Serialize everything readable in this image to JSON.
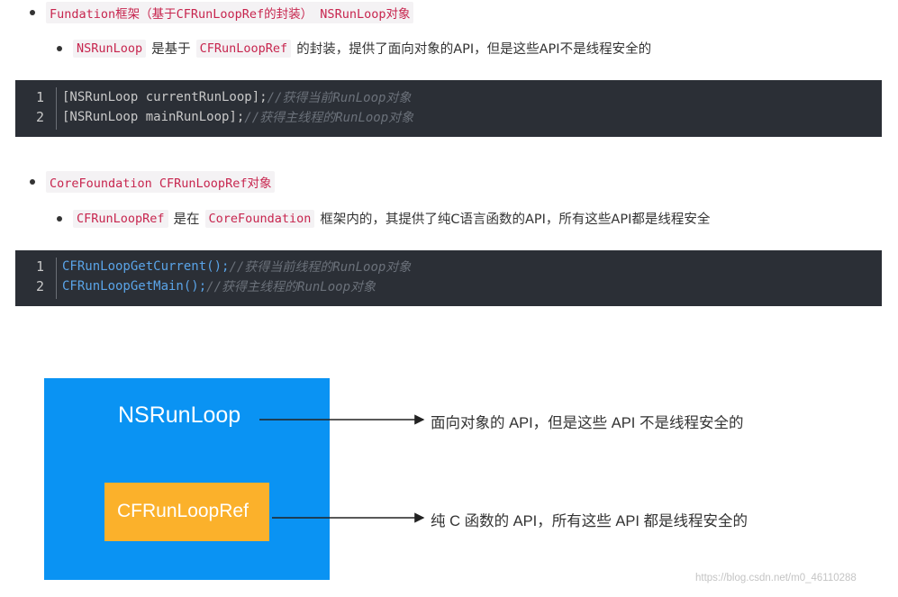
{
  "section1": {
    "heading_code": "Fundation框架（基于CFRunLoopRef的封装） NSRunLoop对象",
    "sub_code": "NSRunLoop",
    "sub_text1": "是基于",
    "sub_code2": "CFRunLoopRef",
    "sub_text2": "的封装，提供了面向对象的API，但是这些API不是线程安全的"
  },
  "code1": {
    "lines": [
      {
        "num": "1",
        "code": "[NSRunLoop currentRunLoop];",
        "comment": "//获得当前RunLoop对象"
      },
      {
        "num": "2",
        "code": "[NSRunLoop mainRunLoop];",
        "comment": "//获得主线程的RunLoop对象"
      }
    ]
  },
  "section2": {
    "heading_code": "CoreFoundation CFRunLoopRef对象",
    "sub_code": "CFRunLoopRef",
    "sub_text1": "是在",
    "sub_code2": "CoreFoundation",
    "sub_text2": "框架内的，其提供了纯C语言函数的API，所有这些API都是线程安全"
  },
  "code2": {
    "lines": [
      {
        "num": "1",
        "code": "CFRunLoopGetCurrent();",
        "comment": "//获得当前线程的RunLoop对象"
      },
      {
        "num": "2",
        "code": "CFRunLoopGetMain();",
        "comment": "//获得主线程的RunLoop对象"
      }
    ]
  },
  "diagram": {
    "outer_label": "NSRunLoop",
    "inner_label": "CFRunLoopRef",
    "outer_desc": "面向对象的 API，但是这些 API 不是线程安全的",
    "inner_desc": "纯 C 函数的 API，所有这些 API 都是线程安全的",
    "outer_color": "#0a93f3",
    "inner_color": "#fbb12b"
  },
  "watermark": "https://blog.csdn.net/m0_46110288"
}
